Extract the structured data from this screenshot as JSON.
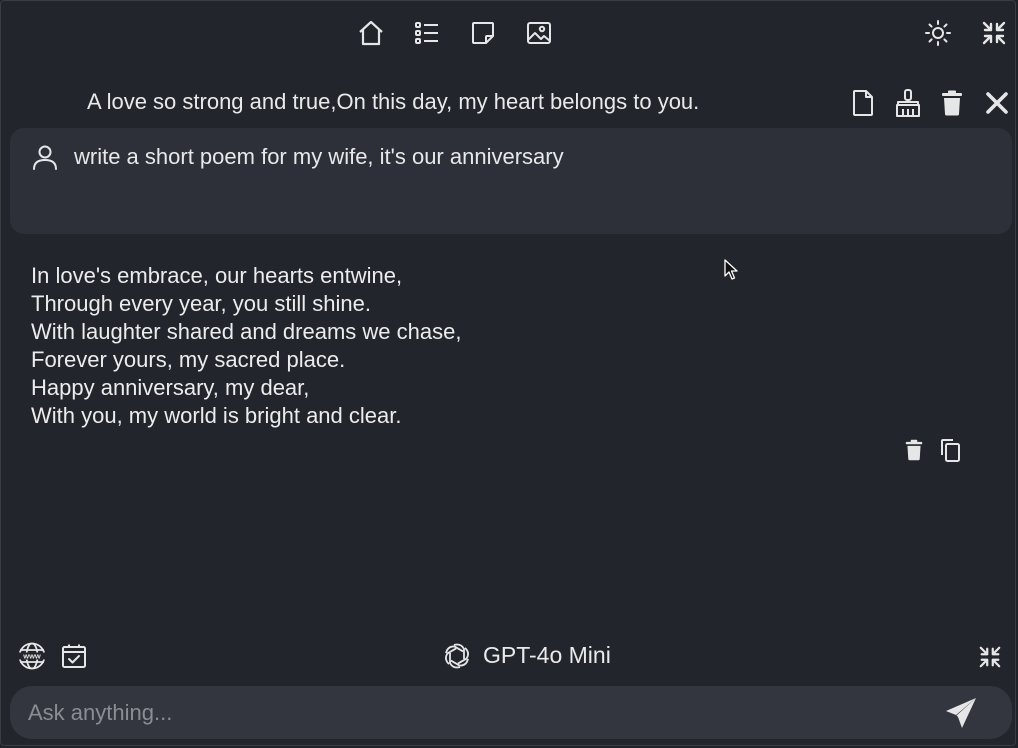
{
  "toolbar": {
    "icons": [
      "home-icon",
      "list-icon",
      "note-icon",
      "image-icon",
      "sun-icon",
      "collapse-icon"
    ]
  },
  "conversation": {
    "title": "A love so strong and true,On this day, my heart belongs to you.",
    "actions": [
      "new-document-icon",
      "broom-icon",
      "trash-icon",
      "close-icon"
    ]
  },
  "user_message": {
    "text": "write a short poem for my wife, it's our anniversary"
  },
  "assistant_message": {
    "lines": [
      "In love's embrace, our hearts entwine,",
      "Through every year, you still shine.",
      "With laughter shared and dreams we chase,",
      "Forever yours, my sacred place.",
      "Happy anniversary, my dear,",
      "With you, my world is bright and clear."
    ],
    "actions": [
      "trash-icon",
      "copy-icon"
    ]
  },
  "footer": {
    "model_name": "GPT-4o Mini",
    "left_icons": [
      "www-globe-icon",
      "calendar-check-icon"
    ],
    "right_icon": "collapse-icon"
  },
  "input": {
    "placeholder": "Ask anything...",
    "value": ""
  },
  "colors": {
    "background": "#22252b",
    "bubble": "#2d3038",
    "input": "#33363e",
    "text": "#e8e8ea",
    "placeholder": "#8a8d94"
  }
}
